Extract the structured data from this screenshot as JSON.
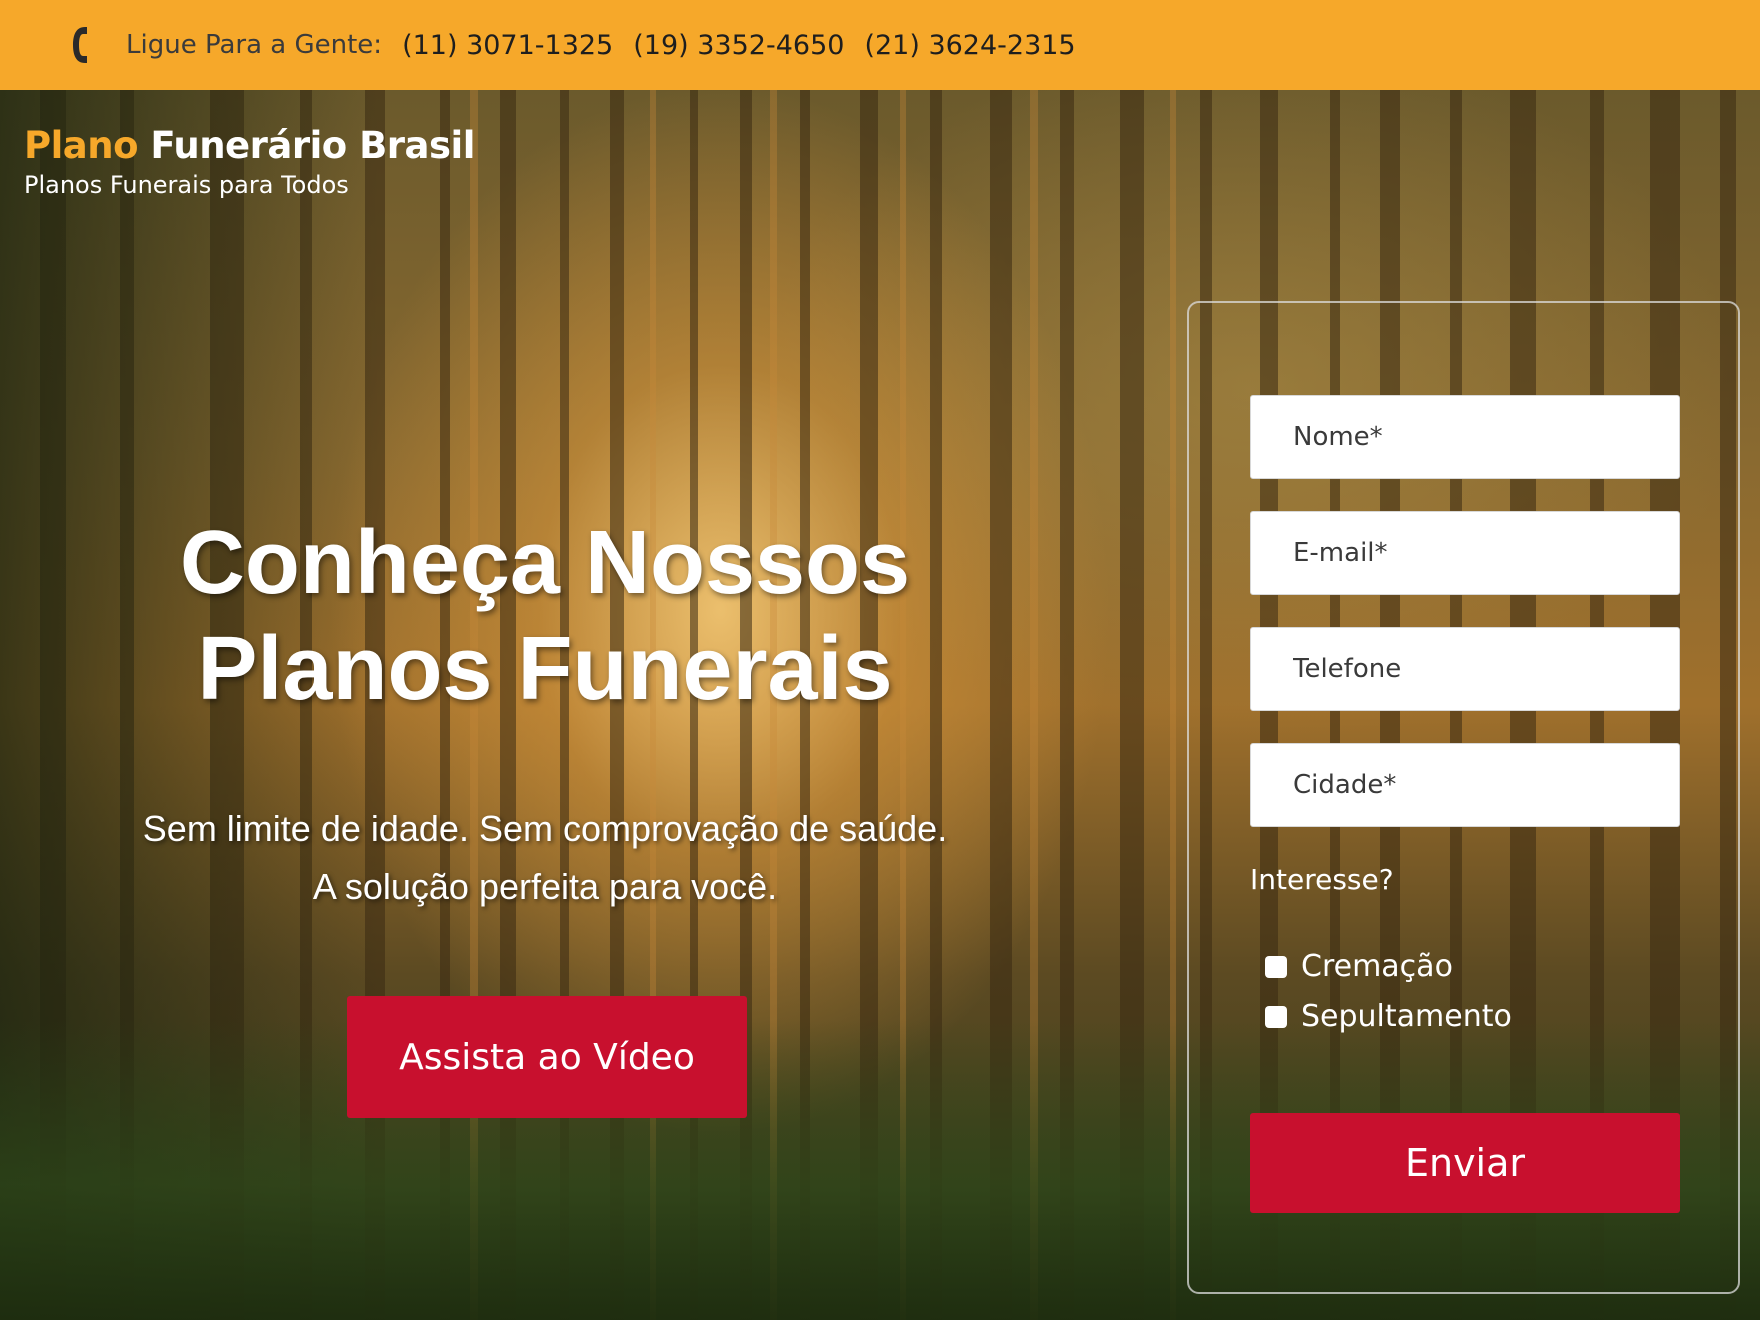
{
  "topbar": {
    "icon": "phone-icon",
    "label": "Ligue Para a Gente:",
    "phones": [
      "(11) 3071-1325",
      "(19) 3352-4650",
      "(21) 3624-2315"
    ]
  },
  "logo": {
    "accent": "Plano",
    "rest": "Funerário Brasil",
    "tagline": "Planos Funerais para Todos"
  },
  "hero": {
    "headline_line1": "Conheça Nossos",
    "headline_line2": "Planos Funerais",
    "sub_line1": "Sem limite de idade. Sem comprovação de saúde.",
    "sub_line2": "A solução perfeita para você.",
    "video_button": "Assista ao Vídeo"
  },
  "form": {
    "name_placeholder": "Nome*",
    "email_placeholder": "E-mail*",
    "phone_placeholder": "Telefone",
    "city_placeholder": "Cidade*",
    "interest_label": "Interesse?",
    "options": [
      "Cremação",
      "Sepultamento"
    ],
    "submit": "Enviar"
  },
  "colors": {
    "topbar": "#f6a82a",
    "accent": "#f6a82a",
    "button": "#c8102e"
  }
}
